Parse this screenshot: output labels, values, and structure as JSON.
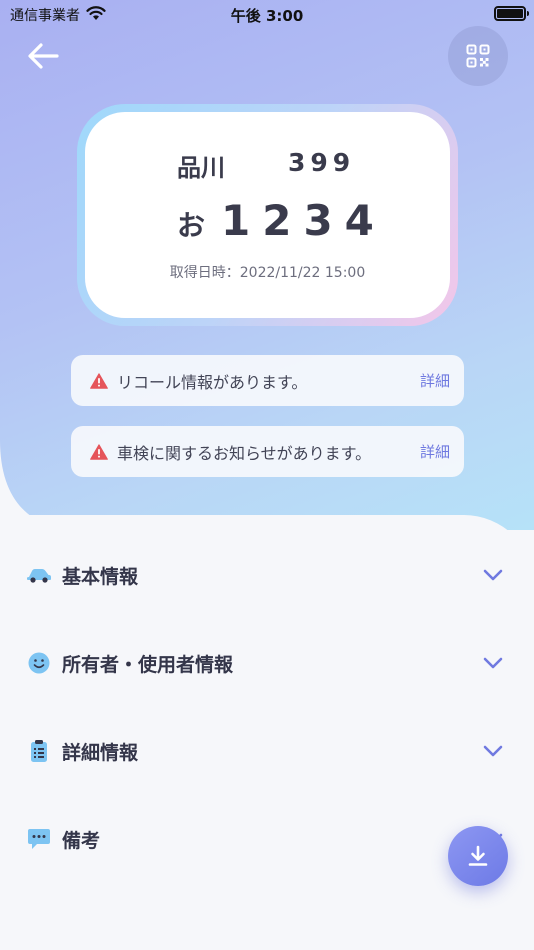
{
  "status_bar": {
    "carrier": "通信事業者",
    "time": "午後 3:00"
  },
  "header": {
    "back_icon": "arrow-left-icon",
    "qr_icon": "qr-code-icon"
  },
  "plate": {
    "region": "品川",
    "class_number": "399",
    "kana": "お",
    "number": "1234",
    "acquired": "取得日時：2022/11/22 15:00"
  },
  "notices": [
    {
      "text": "リコール情報があります。",
      "link": "詳細",
      "icon": "warning-icon",
      "color": "#e5545a"
    },
    {
      "text": "車検に関するお知らせがあります。",
      "link": "詳細",
      "icon": "warning-icon",
      "color": "#e5545a"
    }
  ],
  "sections": [
    {
      "label": "基本情報",
      "icon": "car-icon"
    },
    {
      "label": "所有者・使用者情報",
      "icon": "smile-icon"
    },
    {
      "label": "詳細情報",
      "icon": "clipboard-icon"
    },
    {
      "label": "備考",
      "icon": "chat-bubble-icon"
    }
  ],
  "fab": {
    "icon": "download-icon"
  },
  "colors": {
    "accent": "#6f79e0",
    "icon_blue": "#7dc4f2",
    "warning": "#e5545a"
  }
}
